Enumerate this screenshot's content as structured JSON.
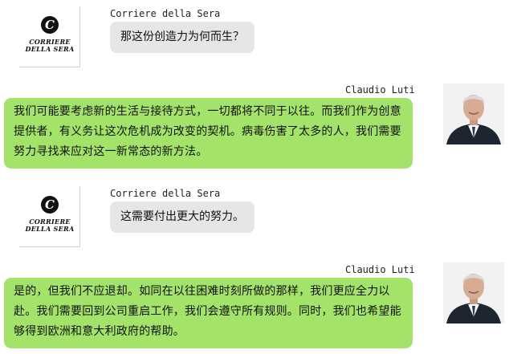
{
  "messages": [
    {
      "sender": "Corriere della Sera",
      "text": "那这份创造力为何而生？",
      "logo_line1": "CORRIERE",
      "logo_line2": "DELLA SERA",
      "logo_mark": "C"
    },
    {
      "sender": "Claudio Luti",
      "text": "我们可能要考虑新的生活与接待方式，一切都将不同于以往。而我们作为创意提供者，有义务让这次危机成为改变的契机。病毒伤害了太多的人，我们需要努力寻找来应对这一新常态的新方法。"
    },
    {
      "sender": "Corriere della Sera",
      "text": "这需要付出更大的努力。",
      "logo_line1": "CORRIERE",
      "logo_line2": "DELLA SERA",
      "logo_mark": "C"
    },
    {
      "sender": "Claudio Luti",
      "text": "是的，但我们不应退却。如同在以往困难时刻所做的那样，我们更应全力以赴。我们需要回到公司重启工作，我们会遵守所有规则。同时，我们也希望能够得到欧洲和意大利政府的帮助。"
    }
  ],
  "colors": {
    "interviewer_bubble": "#e6e6e6",
    "respondent_bubble": "#a3e36a"
  }
}
